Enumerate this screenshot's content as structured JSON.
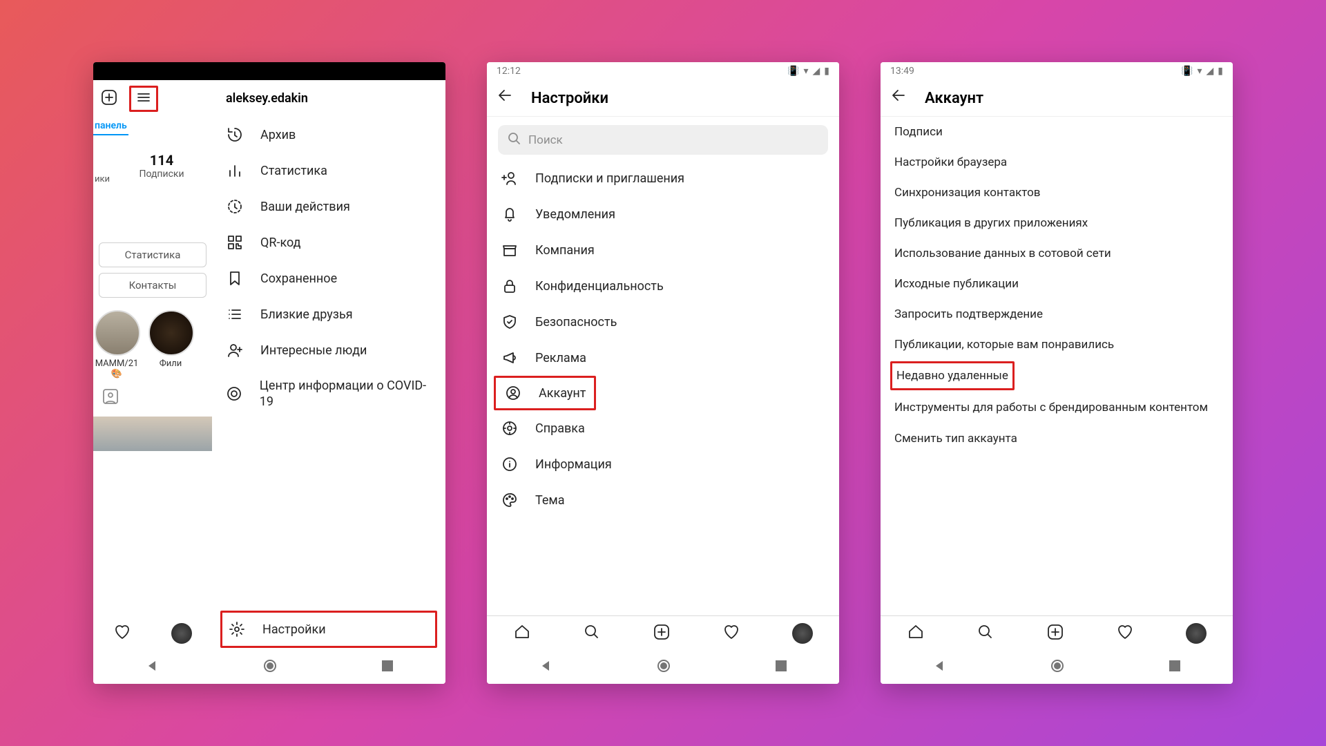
{
  "screen1": {
    "username": "aleksey.edakin",
    "panel_label": "панель",
    "stat_number": "114",
    "stat_label": "Подписки",
    "row_label_iki": "ики",
    "btn_stats": "Статистика",
    "btn_contacts": "Контакты",
    "story1": "МАММ/21 🎨",
    "story2": "Фили",
    "menu": {
      "archive": "Архив",
      "stats": "Статистика",
      "activity": "Ваши действия",
      "qr": "QR-код",
      "saved": "Сохраненное",
      "closefriends": "Близкие друзья",
      "discover": "Интересные люди",
      "covid": "Центр информации о COVID-19",
      "settings": "Настройки"
    }
  },
  "screen2": {
    "time": "12:12",
    "title": "Настройки",
    "search_placeholder": "Поиск",
    "items": {
      "follow": "Подписки и приглашения",
      "notifications": "Уведомления",
      "business": "Компания",
      "privacy": "Конфиденциальность",
      "security": "Безопасность",
      "ads": "Реклама",
      "account": "Аккаунт",
      "help": "Справка",
      "about": "Информация",
      "theme": "Тема"
    }
  },
  "screen3": {
    "time": "13:49",
    "title": "Аккаунт",
    "items": [
      "Подписи",
      "Настройки браузера",
      "Синхронизация контактов",
      "Публикация в других приложениях",
      "Использование данных в сотовой сети",
      "Исходные публикации",
      "Запросить подтверждение",
      "Публикации, которые вам понравились",
      "Недавно удаленные",
      "Инструменты для работы с брендированным контентом"
    ],
    "switch": "Сменить тип аккаунта"
  }
}
